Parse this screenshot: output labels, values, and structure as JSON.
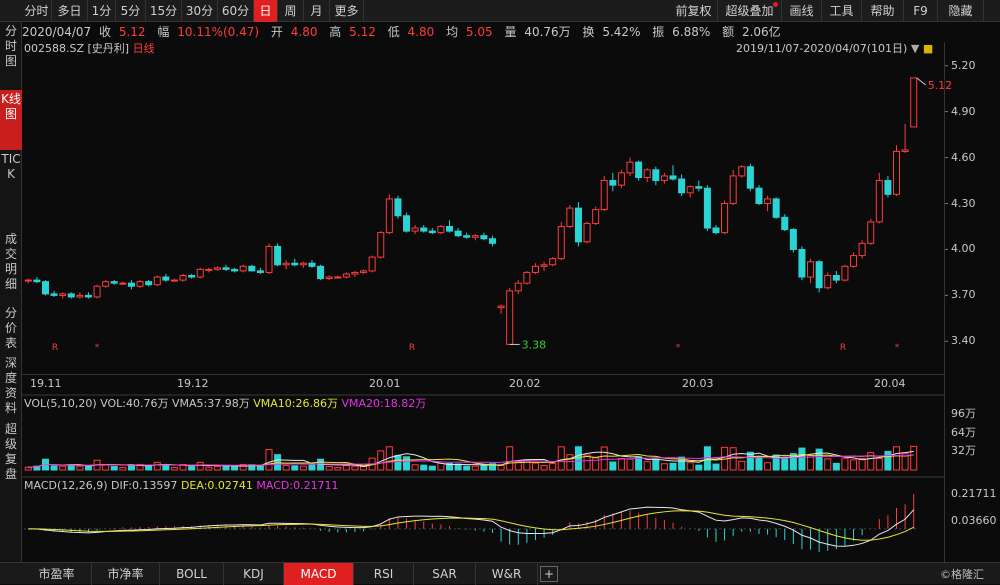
{
  "toolbar": {
    "tabs": [
      "分时",
      "多日",
      "1分",
      "5分",
      "15分",
      "30分",
      "60分",
      "日",
      "周",
      "月",
      "更多"
    ],
    "active_tab": "日",
    "right_buttons": [
      "前复权",
      "超级叠加",
      "画线",
      "工具",
      "帮助",
      "F9",
      "隐藏"
    ]
  },
  "sidebar": {
    "items": [
      "分时图",
      "K线图",
      "TICK",
      "成交明细",
      "分价表",
      "深度资料",
      "超级复盘"
    ],
    "active": "K线图"
  },
  "info": {
    "date": "2020/04/07",
    "close_label": "收",
    "close": "5.12",
    "change_label": "幅",
    "change": "10.11%(0.47)",
    "open_label": "开",
    "open": "4.80",
    "high_label": "高",
    "high": "5.12",
    "low_label": "低",
    "low": "4.80",
    "avg_label": "均",
    "avg": "5.05",
    "volume_label": "量",
    "volume": "40.76万",
    "turnover_label": "换",
    "turnover": "5.42%",
    "amplitude_label": "振",
    "amplitude": "6.88%",
    "amount_label": "额",
    "amount": "2.06亿"
  },
  "chart_title": {
    "code": "002588.SZ",
    "name": "[史丹利]",
    "period": "日线"
  },
  "date_range": "2019/11/07-2020/04/07(101日)",
  "volume_header": {
    "name": "VOL(5,10,20)",
    "vol": "VOL:40.76万",
    "vma5": "VMA5:37.98万",
    "vma10": "VMA10:26.86万",
    "vma20": "VMA20:18.82万"
  },
  "macd_header": {
    "name": "MACD(12,26,9)",
    "dif": "DIF:0.13597",
    "dea": "DEA:0.02741",
    "macd": "MACD:0.21711"
  },
  "bottom_tabs": [
    "市盈率",
    "市净率",
    "BOLL",
    "KDJ",
    "MACD",
    "RSI",
    "SAR",
    "W&R"
  ],
  "bottom_active": "MACD",
  "watermark": "©格隆汇",
  "colors": {
    "up": "#ff3b3b",
    "down": "#2ad4d4",
    "yellow": "#e6e632",
    "magenta": "#e632e6",
    "white": "#e8e8e8",
    "green_label": "#33cc33"
  },
  "chart_data": [
    {
      "type": "candlestick",
      "title": "002588.SZ [史丹利] 日线",
      "x_tick_labels": [
        "19.11",
        "19.12",
        "20.01",
        "20.02",
        "20.03",
        "20.04"
      ],
      "y_tick_labels": [
        "5.20",
        "4.90",
        "4.60",
        "4.30",
        "4.00",
        "3.70",
        "3.40"
      ],
      "ylim": [
        3.2,
        5.25
      ],
      "annotations": [
        {
          "label": "5.12",
          "kind": "high"
        },
        {
          "label": "3.38",
          "kind": "low"
        }
      ],
      "markers": [
        "R",
        "*",
        "R",
        "*",
        "R",
        "*"
      ],
      "ohlc": [
        [
          3.8,
          3.81,
          3.78,
          3.8
        ],
        [
          3.8,
          3.82,
          3.78,
          3.79
        ],
        [
          3.79,
          3.8,
          3.7,
          3.71
        ],
        [
          3.71,
          3.73,
          3.69,
          3.7
        ],
        [
          3.7,
          3.72,
          3.68,
          3.71
        ],
        [
          3.71,
          3.72,
          3.68,
          3.69
        ],
        [
          3.69,
          3.72,
          3.68,
          3.7
        ],
        [
          3.7,
          3.72,
          3.68,
          3.69
        ],
        [
          3.69,
          3.77,
          3.68,
          3.76
        ],
        [
          3.76,
          3.8,
          3.75,
          3.79
        ],
        [
          3.79,
          3.8,
          3.77,
          3.78
        ],
        [
          3.78,
          3.79,
          3.77,
          3.78
        ],
        [
          3.78,
          3.8,
          3.74,
          3.76
        ],
        [
          3.76,
          3.8,
          3.75,
          3.79
        ],
        [
          3.79,
          3.8,
          3.76,
          3.77
        ],
        [
          3.77,
          3.83,
          3.76,
          3.82
        ],
        [
          3.82,
          3.84,
          3.79,
          3.8
        ],
        [
          3.8,
          3.81,
          3.79,
          3.8
        ],
        [
          3.8,
          3.84,
          3.79,
          3.83
        ],
        [
          3.83,
          3.84,
          3.81,
          3.82
        ],
        [
          3.82,
          3.88,
          3.81,
          3.87
        ],
        [
          3.87,
          3.88,
          3.85,
          3.87
        ],
        [
          3.87,
          3.89,
          3.86,
          3.88
        ],
        [
          3.88,
          3.9,
          3.86,
          3.87
        ],
        [
          3.87,
          3.88,
          3.85,
          3.86
        ],
        [
          3.86,
          3.9,
          3.85,
          3.89
        ],
        [
          3.89,
          3.9,
          3.86,
          3.86
        ],
        [
          3.86,
          3.88,
          3.84,
          3.85
        ],
        [
          3.85,
          4.04,
          3.84,
          4.02
        ],
        [
          4.02,
          4.04,
          3.89,
          3.9
        ],
        [
          3.9,
          3.93,
          3.87,
          3.91
        ],
        [
          3.91,
          3.94,
          3.89,
          3.9
        ],
        [
          3.9,
          3.92,
          3.88,
          3.91
        ],
        [
          3.91,
          3.93,
          3.88,
          3.89
        ],
        [
          3.89,
          3.9,
          3.8,
          3.81
        ],
        [
          3.81,
          3.83,
          3.8,
          3.82
        ],
        [
          3.82,
          3.83,
          3.81,
          3.82
        ],
        [
          3.82,
          3.85,
          3.81,
          3.84
        ],
        [
          3.84,
          3.86,
          3.82,
          3.85
        ],
        [
          3.85,
          3.87,
          3.84,
          3.86
        ],
        [
          3.86,
          3.96,
          3.85,
          3.95
        ],
        [
          3.95,
          4.12,
          3.94,
          4.11
        ],
        [
          4.11,
          4.36,
          4.1,
          4.33
        ],
        [
          4.33,
          4.35,
          4.2,
          4.22
        ],
        [
          4.22,
          4.24,
          4.11,
          4.12
        ],
        [
          4.12,
          4.16,
          4.1,
          4.14
        ],
        [
          4.14,
          4.16,
          4.11,
          4.12
        ],
        [
          4.12,
          4.14,
          4.1,
          4.11
        ],
        [
          4.11,
          4.16,
          4.1,
          4.15
        ],
        [
          4.15,
          4.19,
          4.11,
          4.12
        ],
        [
          4.12,
          4.14,
          4.08,
          4.09
        ],
        [
          4.09,
          4.11,
          4.07,
          4.08
        ],
        [
          4.08,
          4.1,
          4.06,
          4.09
        ],
        [
          4.09,
          4.11,
          4.06,
          4.07
        ],
        [
          4.07,
          4.09,
          4.02,
          4.04
        ],
        [
          3.62,
          3.64,
          3.58,
          3.63
        ],
        [
          3.38,
          3.75,
          3.38,
          3.73
        ],
        [
          3.73,
          3.8,
          3.71,
          3.78
        ],
        [
          3.78,
          3.86,
          3.77,
          3.85
        ],
        [
          3.85,
          3.91,
          3.84,
          3.89
        ],
        [
          3.89,
          3.92,
          3.86,
          3.9
        ],
        [
          3.9,
          3.95,
          3.89,
          3.94
        ],
        [
          3.94,
          4.18,
          3.93,
          4.15
        ],
        [
          4.15,
          4.29,
          4.14,
          4.27
        ],
        [
          4.27,
          4.31,
          4.02,
          4.05
        ],
        [
          4.05,
          4.18,
          4.04,
          4.17
        ],
        [
          4.17,
          4.28,
          4.16,
          4.26
        ],
        [
          4.26,
          4.48,
          4.25,
          4.45
        ],
        [
          4.45,
          4.5,
          4.38,
          4.42
        ],
        [
          4.42,
          4.52,
          4.4,
          4.5
        ],
        [
          4.5,
          4.6,
          4.48,
          4.57
        ],
        [
          4.57,
          4.58,
          4.45,
          4.47
        ],
        [
          4.47,
          4.53,
          4.44,
          4.52
        ],
        [
          4.52,
          4.54,
          4.42,
          4.45
        ],
        [
          4.45,
          4.5,
          4.43,
          4.48
        ],
        [
          4.48,
          4.55,
          4.45,
          4.46
        ],
        [
          4.46,
          4.49,
          4.35,
          4.37
        ],
        [
          4.37,
          4.42,
          4.34,
          4.41
        ],
        [
          4.41,
          4.45,
          4.38,
          4.4
        ],
        [
          4.4,
          4.42,
          4.12,
          4.14
        ],
        [
          4.14,
          4.16,
          4.1,
          4.11
        ],
        [
          4.11,
          4.32,
          4.1,
          4.3
        ],
        [
          4.3,
          4.52,
          4.29,
          4.48
        ],
        [
          4.48,
          4.55,
          4.47,
          4.54
        ],
        [
          4.54,
          4.56,
          4.38,
          4.4
        ],
        [
          4.4,
          4.42,
          4.29,
          4.3
        ],
        [
          4.3,
          4.35,
          4.25,
          4.33
        ],
        [
          4.33,
          4.34,
          4.2,
          4.21
        ],
        [
          4.21,
          4.23,
          4.12,
          4.13
        ],
        [
          4.13,
          4.14,
          3.98,
          4.0
        ],
        [
          4.0,
          4.02,
          3.8,
          3.82
        ],
        [
          3.82,
          3.94,
          3.78,
          3.92
        ],
        [
          3.92,
          3.93,
          3.72,
          3.75
        ],
        [
          3.75,
          3.85,
          3.74,
          3.83
        ],
        [
          3.83,
          3.86,
          3.78,
          3.8
        ],
        [
          3.8,
          3.9,
          3.79,
          3.89
        ],
        [
          3.89,
          3.98,
          3.88,
          3.96
        ],
        [
          3.96,
          4.06,
          3.94,
          4.04
        ],
        [
          4.04,
          4.2,
          4.03,
          4.18
        ],
        [
          4.18,
          4.5,
          4.17,
          4.45
        ],
        [
          4.45,
          4.48,
          4.34,
          4.36
        ],
        [
          4.36,
          4.68,
          4.35,
          4.64
        ],
        [
          4.64,
          4.82,
          4.63,
          4.65
        ],
        [
          4.8,
          5.12,
          4.8,
          5.12
        ]
      ]
    },
    {
      "type": "bar",
      "title": "VOL(5,10,20)",
      "y_tick_labels": [
        "96万",
        "64万",
        "32万"
      ],
      "ylim": [
        0,
        100
      ],
      "series": [
        {
          "name": "VOL",
          "values_note": "daily volume in 万"
        },
        {
          "name": "VMA5"
        },
        {
          "name": "VMA10"
        },
        {
          "name": "VMA20"
        }
      ]
    },
    {
      "type": "bar",
      "title": "MACD(12,26,9)",
      "y_tick_labels": [
        "0.21711",
        "0.03660"
      ],
      "series": [
        {
          "name": "DIF",
          "last": 0.13597
        },
        {
          "name": "DEA",
          "last": 0.02741
        },
        {
          "name": "MACD",
          "last": 0.21711
        }
      ]
    }
  ]
}
